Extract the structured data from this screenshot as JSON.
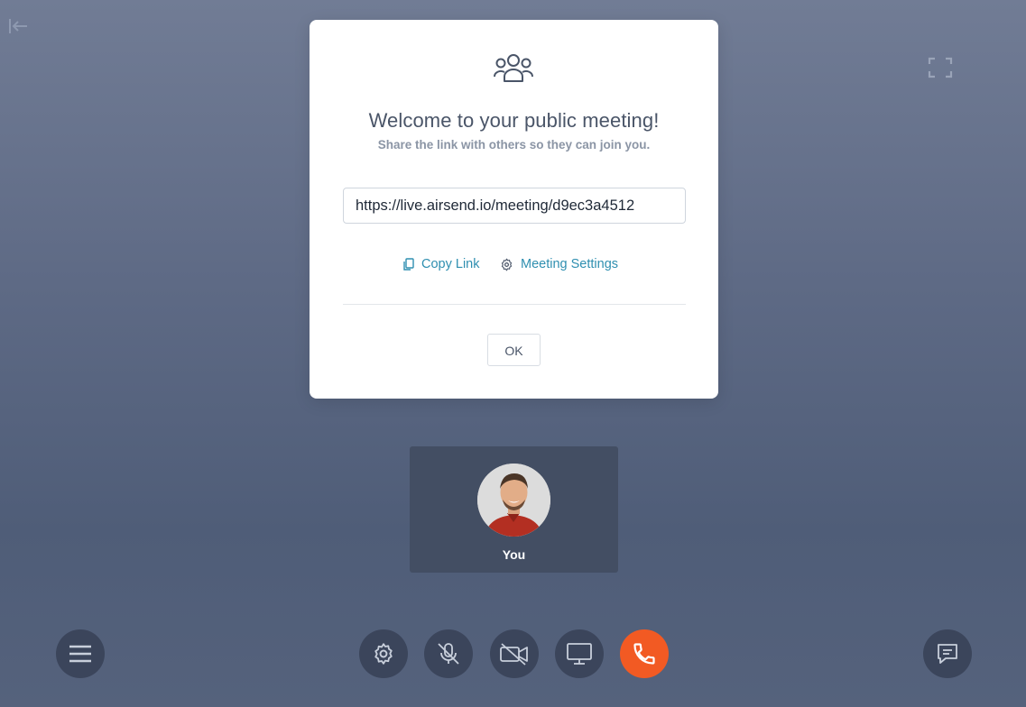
{
  "icons": {
    "collapse": "arrow-left-to-line-icon",
    "fullscreen": "expand-icon",
    "people": "users-group-icon",
    "copy": "copy-icon",
    "settings": "gear-icon"
  },
  "modal": {
    "title": "Welcome to your public meeting!",
    "subtitle": "Share the link with others so they can join you.",
    "link_value": "https://live.airsend.io/meeting/d9ec3a4512",
    "copy_link_label": "Copy Link",
    "meeting_settings_label": "Meeting Settings",
    "ok_label": "OK"
  },
  "participant": {
    "name": "You"
  },
  "controls": [
    {
      "icon": "menu-icon"
    },
    {
      "icon": "gear-icon"
    },
    {
      "icon": "microphone-muted-icon"
    },
    {
      "icon": "video-off-icon"
    },
    {
      "icon": "screen-share-icon"
    },
    {
      "icon": "phone-hangup-icon"
    },
    {
      "icon": "chat-icon"
    }
  ],
  "colors": {
    "accent_link": "#2f8fb0",
    "hangup": "#f25a23",
    "control_bg": "#3b455b",
    "tile_bg": "#434e63"
  }
}
